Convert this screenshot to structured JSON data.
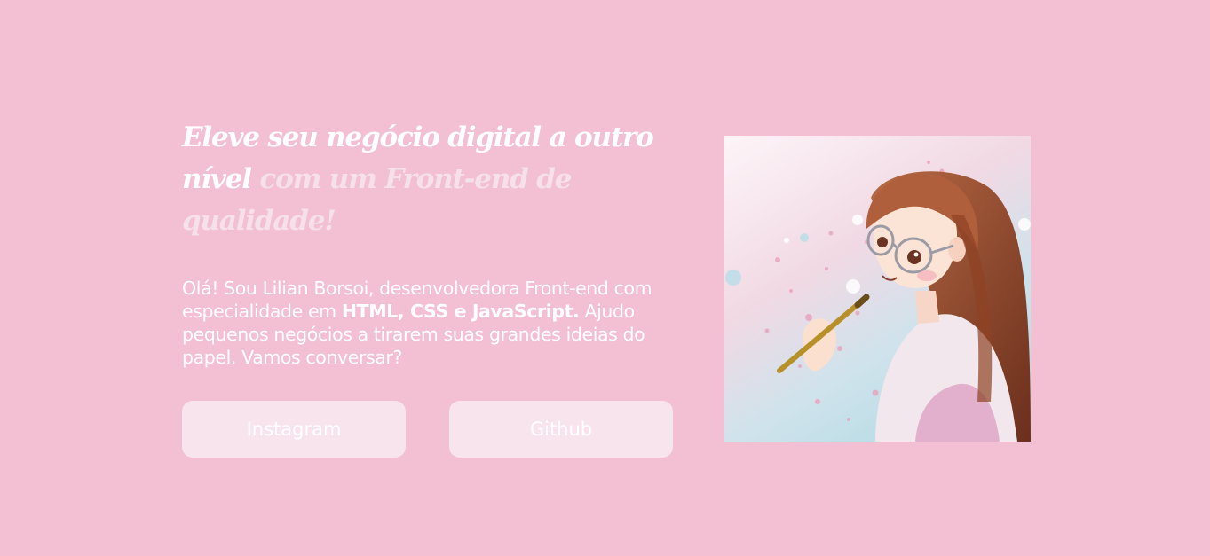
{
  "hero": {
    "headline_part1": "Eleve seu negócio digital a outro nível",
    "headline_part2": "com um Front-end de qualidade!",
    "intro_line1": "Olá! Sou Lilian Borsoi, desenvolvedora Front-end com especialidade em",
    "intro_skills": "HTML, CSS e JavaScript.",
    "intro_line2": "Ajudo pequenos negócios a tirarem suas grandes ideias do papel. Vamos conversar?"
  },
  "buttons": {
    "instagram_label": "Instagram",
    "github_label": "Github"
  },
  "colors": {
    "background": "#f2bfd3",
    "button_bg": "#f8e4ec",
    "accent_text": "#f6e0ea",
    "text": "#ffffff"
  },
  "portrait": {
    "icon": "illustrated-girl-with-paintbrush"
  }
}
